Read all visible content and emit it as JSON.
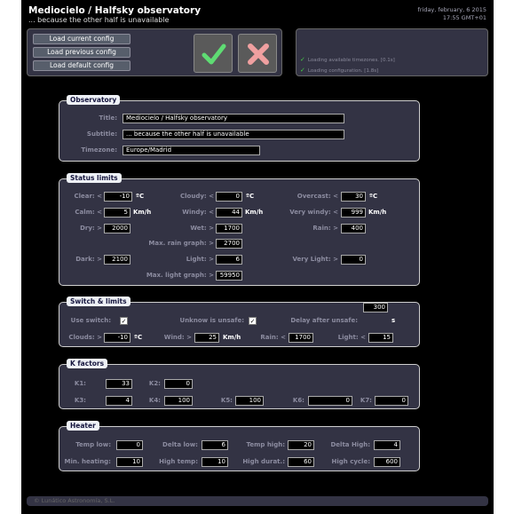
{
  "app": {
    "title": "Mediocielo / Halfsky observatory",
    "subtitle": "... because the other half is unavailable",
    "date": "friday, february, 6 2015",
    "time": "17:55 GMT+01"
  },
  "config": {
    "load_current": "Load current config",
    "load_previous": "Load previous config",
    "load_default": "Load default config"
  },
  "icons": {
    "ok": "checkmark-icon",
    "cancel": "cross-icon",
    "ok_color": "#5fdc73",
    "cancel_color": "#f0a0a0"
  },
  "log": [
    "Loading available timezones. [0.1s]",
    "Loading configuration. [1.8s]"
  ],
  "observatory": {
    "legend": "Observatory",
    "title_label": "Title:",
    "title_value": "Mediocielo / Halfsky observatory",
    "subtitle_label": "Subtitle:",
    "subtitle_value": "... because the other half is unavailable",
    "timezone_label": "Timezone:",
    "timezone_value": "Europe/Madrid"
  },
  "status_limits": {
    "legend": "Status limits",
    "clear_label": "Clear: <",
    "clear": "-10",
    "clear_unit": "ºC",
    "cloudy_label": "Cloudy: <",
    "cloudy": "0",
    "cloudy_unit": "ºC",
    "overcast_label": "Overcast: <",
    "overcast": "30",
    "overcast_unit": "ºC",
    "calm_label": "Calm: <",
    "calm": "5",
    "calm_unit": "Km/h",
    "windy_label": "Windy: <",
    "windy": "44",
    "windy_unit": "Km/h",
    "very_windy_label": "Very windy: <",
    "very_windy": "999",
    "very_windy_unit": "Km/h",
    "dry_label": "Dry: >",
    "dry": "2000",
    "wet_label": "Wet: >",
    "wet": "1700",
    "rain_label": "Rain: >",
    "rain": "400",
    "max_rain_label": "Max. rain graph: >",
    "max_rain": "2700",
    "dark_label": "Dark: >",
    "dark": "2100",
    "light_label": "Light: >",
    "light": "6",
    "very_light_label": "Very Light: >",
    "very_light": "0",
    "max_light_label": "Max. light graph: >",
    "max_light": "59950"
  },
  "switch_limits": {
    "legend": "Switch & limits",
    "use_switch_label": "Use switch:",
    "use_switch": "✓",
    "unknow_label": "Unknow is unsafe:",
    "unknow": "✓",
    "delay_label": "Delay after unsafe:",
    "delay": "300",
    "delay_unit": "s",
    "clouds_label": "Clouds: >",
    "clouds": "-10",
    "clouds_unit": "ºC",
    "wind_label": "Wind: >",
    "wind": "25",
    "wind_unit": "Km/h",
    "rain_label": "Rain: <",
    "rain": "1700",
    "light_label": "Light: <",
    "light": "15"
  },
  "k_factors": {
    "legend": "K factors",
    "k1_label": "K1:",
    "k1": "33",
    "k2_label": "K2:",
    "k2": "0",
    "k3_label": "K3:",
    "k3": "4",
    "k4_label": "K4:",
    "k4": "100",
    "k5_label": "K5:",
    "k5": "100",
    "k6_label": "K6:",
    "k6": "0",
    "k7_label": "K7:",
    "k7": "0"
  },
  "heater": {
    "legend": "Heater",
    "temp_low_label": "Temp low:",
    "temp_low": "0",
    "delta_low_label": "Delta low:",
    "delta_low": "6",
    "temp_high_label": "Temp high:",
    "temp_high": "20",
    "delta_high_label": "Delta High:",
    "delta_high": "4",
    "min_heating_label": "Min. heating:",
    "min_heating": "10",
    "high_temp_label": "High temp:",
    "high_temp": "10",
    "high_durat_label": "High durat.:",
    "high_durat": "60",
    "high_cycle_label": "High cycle:",
    "high_cycle": "600"
  },
  "footer": {
    "text": "© Lunático Astronomía, S.L."
  }
}
